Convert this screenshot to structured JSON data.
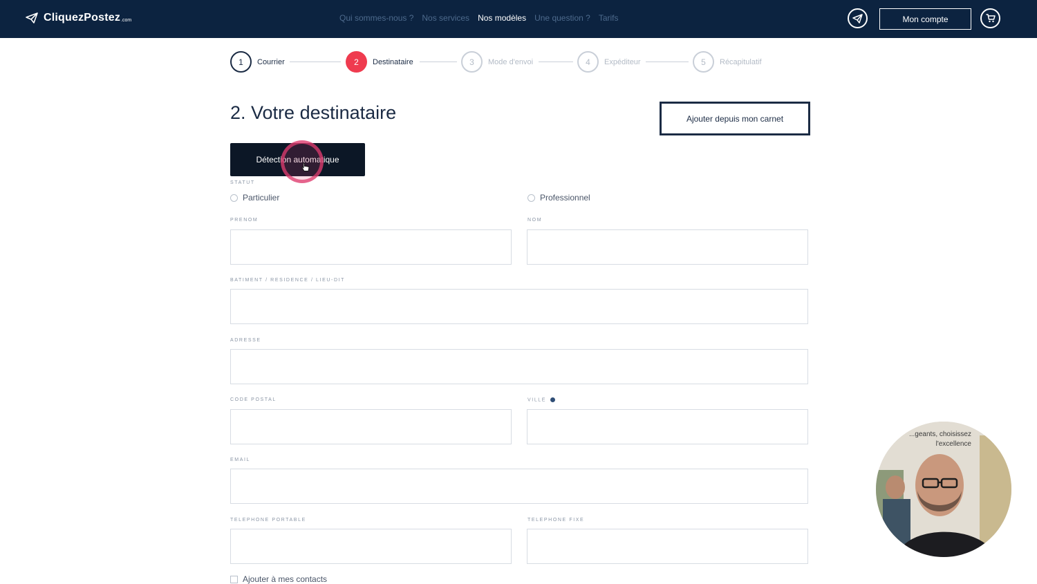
{
  "header": {
    "brand": "CliquezPostez",
    "brand_tld": ".com",
    "nav": [
      {
        "label": "Qui sommes-nous ?",
        "active": false
      },
      {
        "label": "Nos services",
        "active": false
      },
      {
        "label": "Nos modèles",
        "active": true
      },
      {
        "label": "Une question ?",
        "active": false
      },
      {
        "label": "Tarifs",
        "active": false
      }
    ],
    "account_label": "Mon compte"
  },
  "stepper": {
    "steps": [
      {
        "num": "1",
        "label": "Courrier",
        "state": "done"
      },
      {
        "num": "2",
        "label": "Destinataire",
        "state": "current"
      },
      {
        "num": "3",
        "label": "Mode d'envoi",
        "state": "todo"
      },
      {
        "num": "4",
        "label": "Expéditeur",
        "state": "todo"
      },
      {
        "num": "5",
        "label": "Récapitulatif",
        "state": "todo"
      }
    ]
  },
  "main": {
    "title": "2. Votre destinataire",
    "carnet_button": "Ajouter depuis mon carnet",
    "detect_button": "Détection automatique"
  },
  "form": {
    "statut_label": "STATUT",
    "statut_options": [
      "Particulier",
      "Professionnel"
    ],
    "prenom_label": "PRENOM",
    "nom_label": "NOM",
    "batiment_label": "BATIMENT / RESIDENCE / LIEU-DIT",
    "adresse_label": "ADRESSE",
    "code_postal_label": "CODE POSTAL",
    "ville_label": "VILLE",
    "email_label": "EMAIL",
    "tel_portable_label": "TELEPHONE PORTABLE",
    "tel_fixe_label": "TELEPHONE FIXE",
    "add_contact_label": "Ajouter à mes contacts"
  },
  "webcam": {
    "background_text": "...geants, choisissez l'excellence"
  },
  "colors": {
    "header_bg": "#0c2340",
    "accent": "#ef3b4f",
    "dark_button": "#0c1726"
  }
}
